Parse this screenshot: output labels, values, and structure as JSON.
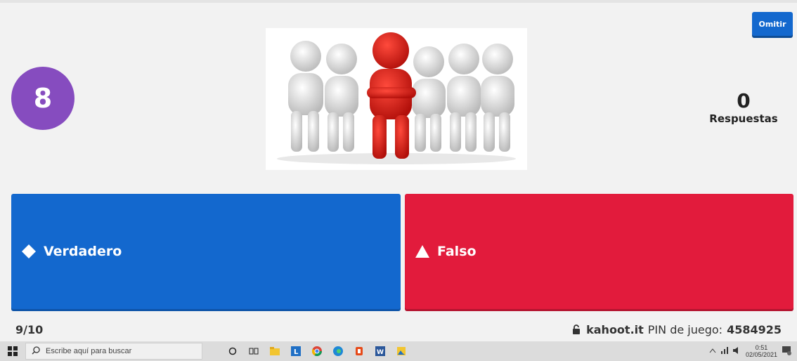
{
  "header": {
    "skip_label": "Omitir"
  },
  "timer": {
    "value": "8",
    "color": "#864cbf"
  },
  "answers": {
    "count": "0",
    "label": "Respuestas"
  },
  "question_image": {
    "description_icon": "team-leader-figures-image"
  },
  "options": [
    {
      "label": "Verdadero",
      "shape": "diamond",
      "color": "#1368ce"
    },
    {
      "label": "Falso",
      "shape": "triangle",
      "color": "#e21b3c"
    }
  ],
  "footer": {
    "progress": "9/10",
    "site": "kahoot.it",
    "pin_label": "PIN de juego:",
    "pin": "4584925"
  },
  "taskbar": {
    "search_placeholder": "Escribe aquí para buscar",
    "time": "0:51",
    "date": "02/05/2021",
    "notification_count": "1"
  }
}
